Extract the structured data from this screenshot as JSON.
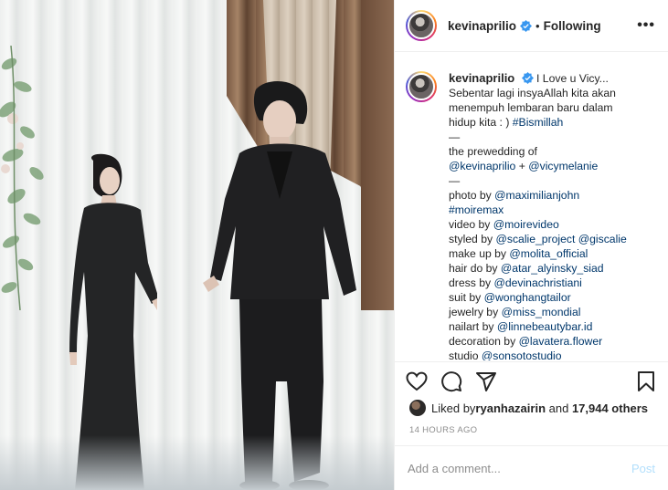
{
  "photo": {
    "alt": "prewedding photo"
  },
  "header": {
    "username": "kevinaprilio",
    "separator": "•",
    "follow_status": "Following",
    "more_label": "•••"
  },
  "caption": {
    "username": "kevinaprilio",
    "lines": [
      {
        "text": "I Love u Vicy..."
      },
      {
        "text": "Sebentar lagi insyaAllah kita akan"
      },
      {
        "text": "menempuh lembaran baru dalam"
      },
      {
        "pre": "hidup kita : ) ",
        "tag": "#Bismillah"
      },
      {
        "text": "—"
      },
      {
        "text": "the prewedding of"
      },
      {
        "tag": "@kevinaprilio",
        "mid": " + ",
        "tag2": "@vicymelanie"
      },
      {
        "text": "—"
      },
      {
        "pre": "photo by ",
        "tag": "@maximilianjohn"
      },
      {
        "tag": "#moiremax"
      },
      {
        "pre": "video by ",
        "tag": "@moirevideo"
      },
      {
        "pre": "styled by ",
        "tag": "@scalie_project",
        "mid": " ",
        "tag2": "@giscalie"
      },
      {
        "pre": "make up by ",
        "tag": "@molita_official"
      },
      {
        "pre": "hair do by ",
        "tag": "@atar_alyinsky_siad"
      },
      {
        "pre": "dress by ",
        "tag": "@devinachristiani"
      },
      {
        "pre": "suit by ",
        "tag": "@wonghangtailor"
      },
      {
        "pre": "jewelry by ",
        "tag": "@miss_mondial"
      },
      {
        "pre": "nailart by ",
        "tag": "@linnebeautybar.id"
      },
      {
        "pre": "decoration by ",
        "tag": "@lavatera.flower"
      },
      {
        "pre": "studio ",
        "tag": "@sonsotostudio"
      }
    ]
  },
  "actions": {
    "like_icon": "heart-icon",
    "comment_icon": "speech-bubble-icon",
    "share_icon": "paper-plane-icon",
    "save_icon": "bookmark-icon"
  },
  "likes": {
    "prefix": "Liked by ",
    "user": "ryanhazairin",
    "middle": " and ",
    "others": "17,944 others"
  },
  "timestamp": "14 HOURS AGO",
  "comment": {
    "placeholder": "Add a comment...",
    "post_label": "Post"
  },
  "colors": {
    "link": "#00376b",
    "verified": "#3897f0",
    "post_disabled": "#b2dffc",
    "muted": "#8e8e8e"
  }
}
